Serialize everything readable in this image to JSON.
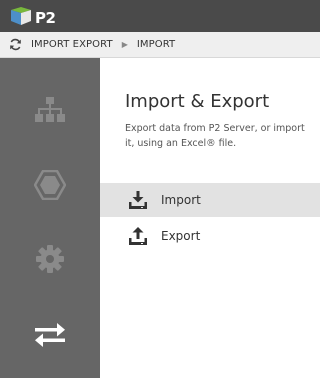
{
  "app": {
    "logo_text": "P2"
  },
  "breadcrumb": {
    "items": [
      "IMPORT EXPORT",
      "IMPORT"
    ]
  },
  "sidebar": {
    "items": [
      {
        "icon": "hierarchy-icon",
        "active": false
      },
      {
        "icon": "hexagon-icon",
        "active": false
      },
      {
        "icon": "gear-icon",
        "active": false
      },
      {
        "icon": "import-export-icon",
        "active": true
      }
    ]
  },
  "main": {
    "title": "Import & Export",
    "description": "Export data from P2 Server, or import it, using an Excel® file.",
    "menu": [
      {
        "label": "Import",
        "icon": "download-icon",
        "selected": true
      },
      {
        "label": "Export",
        "icon": "upload-icon",
        "selected": false
      }
    ]
  },
  "colors": {
    "topbar": "#4a4a4a",
    "sidebar": "#666666",
    "logo_accent": "#78b83c",
    "selected_row": "#e2e2e2"
  }
}
